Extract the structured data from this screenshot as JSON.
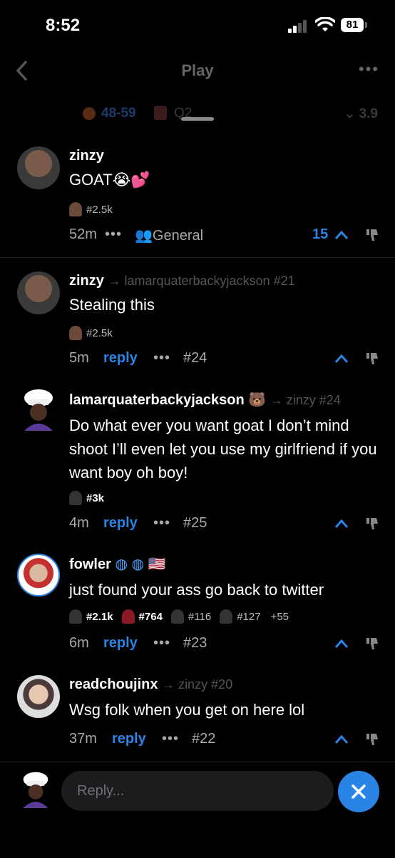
{
  "status": {
    "time": "8:52",
    "battery": "81"
  },
  "nav": {
    "title": "Play"
  },
  "scoreboard": {
    "score": "48-59",
    "quarter": "Q2",
    "odds": "3.9"
  },
  "comments": [
    {
      "user": "zinzy",
      "text": "GOAT😭💕",
      "badge": "#2.5k",
      "age": "52m",
      "channel": "General",
      "votes": "15"
    },
    {
      "user": "zinzy",
      "reply_to": "lamarquaterbackyjackson #21",
      "text": "Stealing this",
      "badge": "#2.5k",
      "age": "5m",
      "reply": "reply",
      "number": "#24"
    },
    {
      "user": "lamarquaterbackyjackson",
      "reply_to": "zinzy #24",
      "text": "Do what ever you want goat I don’t mind shoot I’ll even let you use my girlfriend if you want boy oh boy!",
      "badge": "#3k",
      "age": "4m",
      "reply": "reply",
      "number": "#25"
    },
    {
      "user": "fowler",
      "text": "just found your ass go back to twitter",
      "badges": [
        "#2.1k",
        "#764",
        "#116",
        "#127",
        "+55"
      ],
      "age": "6m",
      "reply": "reply",
      "number": "#23"
    },
    {
      "user": "readchoujinx",
      "reply_to": "zinzy #20",
      "text": "Wsg folk when you get on here lol",
      "age": "37m",
      "reply": "reply",
      "number": "#22"
    }
  ],
  "composer": {
    "placeholder": "Reply..."
  },
  "colors": {
    "accent": "#2a84e6",
    "background": "#000000"
  }
}
